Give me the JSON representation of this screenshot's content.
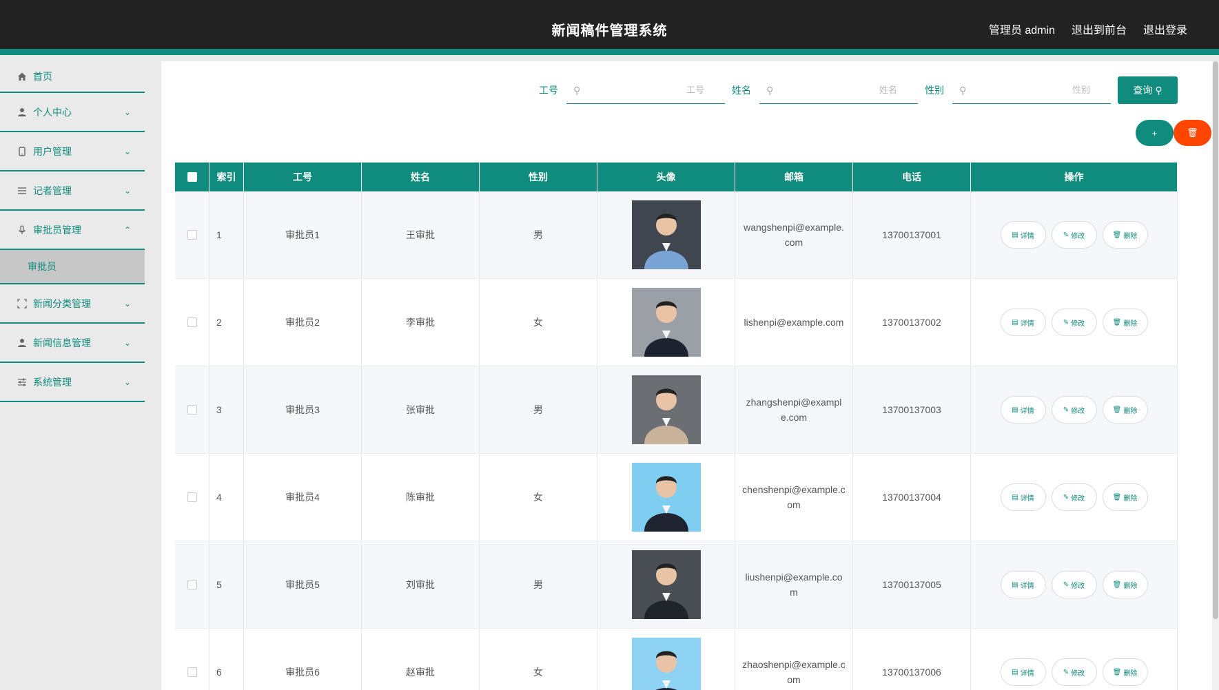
{
  "header": {
    "title": "新闻稿件管理系统",
    "admin": "管理员 admin",
    "to_front": "退出到前台",
    "logout": "退出登录"
  },
  "sidebar": {
    "items": [
      {
        "label": "首页",
        "icon": "home-icon"
      },
      {
        "label": "个人中心",
        "icon": "user-icon"
      },
      {
        "label": "用户管理",
        "icon": "phone-icon"
      },
      {
        "label": "记者管理",
        "icon": "list-icon"
      },
      {
        "label": "审批员管理",
        "icon": "microphone-icon",
        "expanded": true
      },
      {
        "label": "新闻分类管理",
        "icon": "fullscreen-icon"
      },
      {
        "label": "新闻信息管理",
        "icon": "person-icon"
      },
      {
        "label": "系统管理",
        "icon": "sliders-icon"
      }
    ],
    "sub_active": "审批员"
  },
  "filters": {
    "no_label": "工号",
    "no_placeholder": "工号",
    "name_label": "姓名",
    "name_placeholder": "姓名",
    "sex_label": "性别",
    "sex_placeholder": "性别",
    "query": "查询"
  },
  "table": {
    "headers": {
      "index": "索引",
      "no": "工号",
      "name": "姓名",
      "sex": "性别",
      "avatar": "头像",
      "email": "邮箱",
      "phone": "电话",
      "ops": "操作"
    },
    "op_labels": {
      "detail": "详情",
      "edit": "修改",
      "delete": "删除"
    },
    "rows": [
      {
        "index": "1",
        "no": "审批员1",
        "name": "王审批",
        "sex": "男",
        "email": "wangshenpi@example.com",
        "phone": "13700137001"
      },
      {
        "index": "2",
        "no": "审批员2",
        "name": "李审批",
        "sex": "女",
        "email": "lishenpi@example.com",
        "phone": "13700137002"
      },
      {
        "index": "3",
        "no": "审批员3",
        "name": "张审批",
        "sex": "男",
        "email": "zhangshenpi@example.com",
        "phone": "13700137003"
      },
      {
        "index": "4",
        "no": "审批员4",
        "name": "陈审批",
        "sex": "女",
        "email": "chenshenpi@example.com",
        "phone": "13700137004"
      },
      {
        "index": "5",
        "no": "审批员5",
        "name": "刘审批",
        "sex": "男",
        "email": "liushenpi@example.com",
        "phone": "13700137005"
      },
      {
        "index": "6",
        "no": "审批员6",
        "name": "赵审批",
        "sex": "女",
        "email": "zhaoshenpi@example.com",
        "phone": "13700137006"
      }
    ]
  },
  "colors": {
    "accent": "#0f8c7d",
    "danger": "#ff4500",
    "header_bg": "#222222"
  }
}
